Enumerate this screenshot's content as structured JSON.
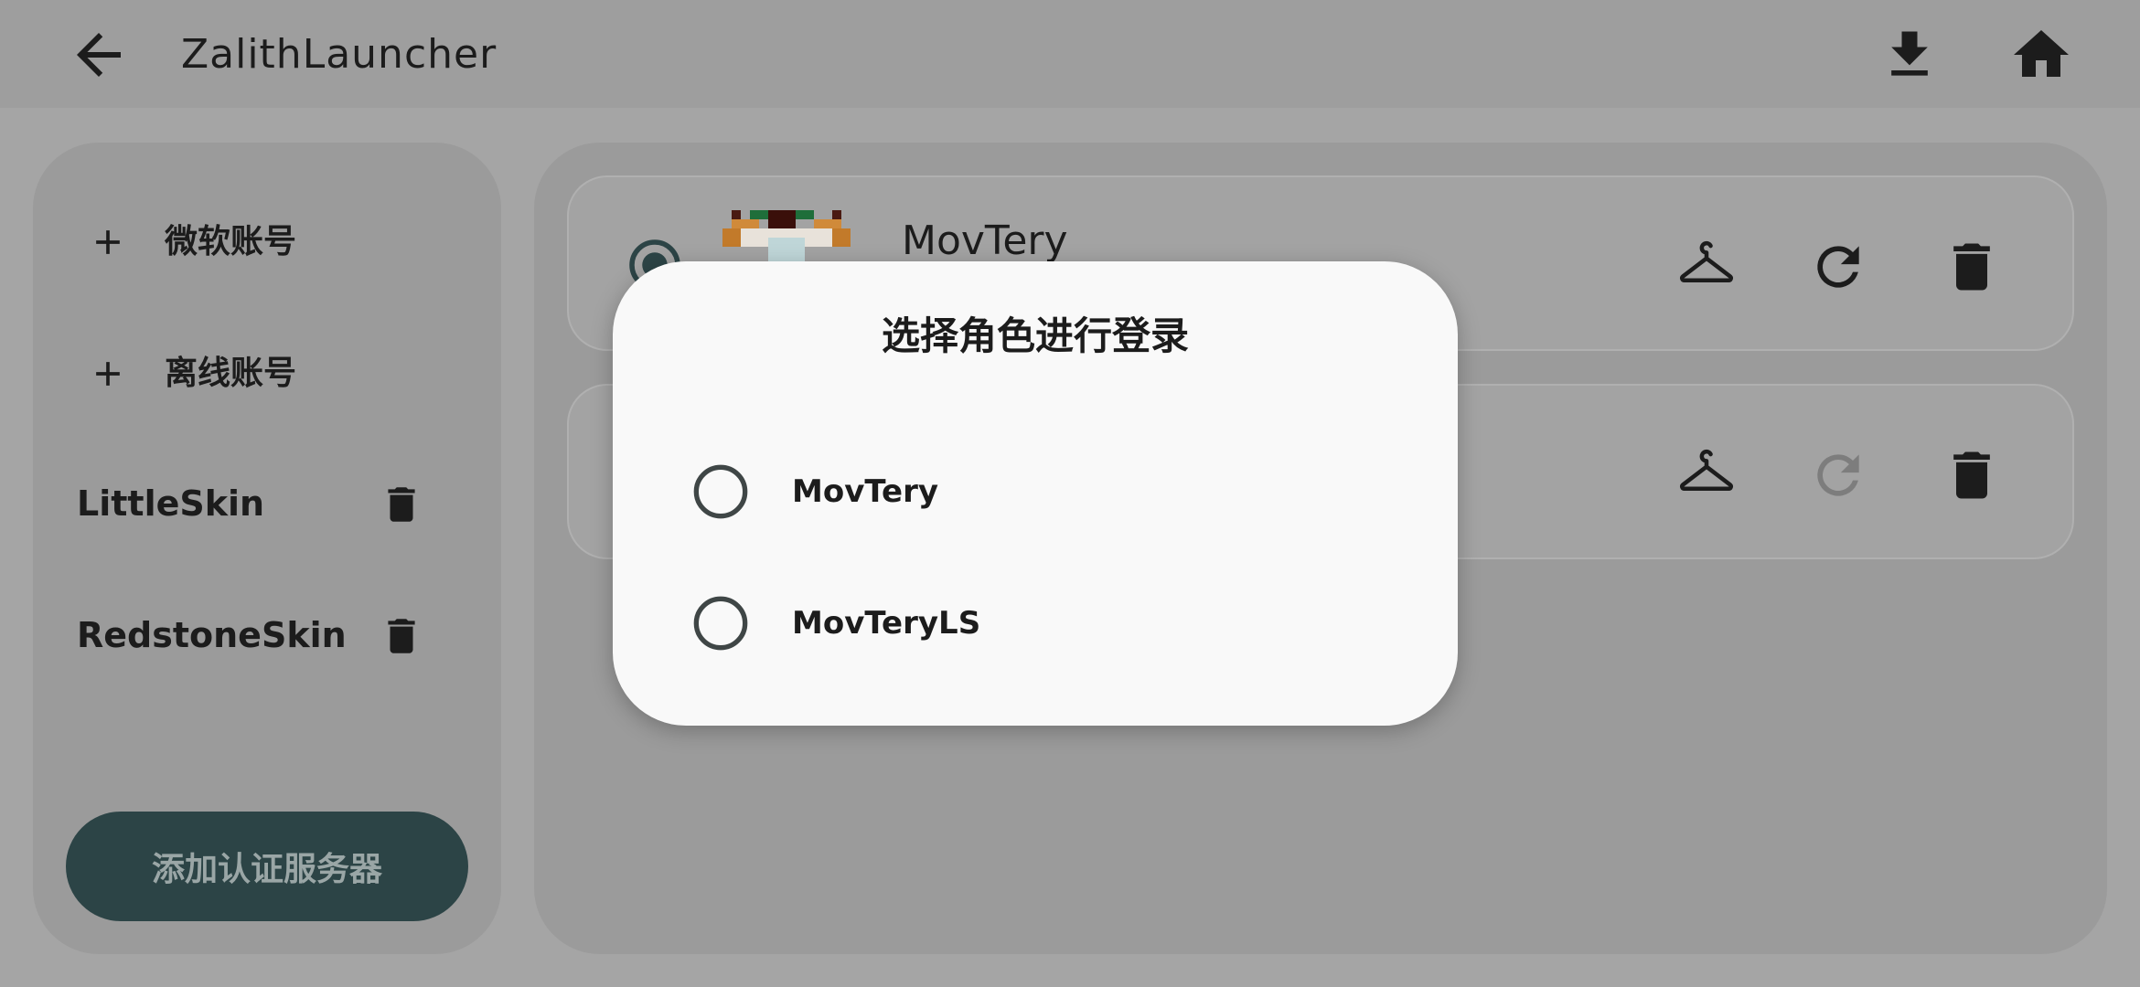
{
  "app": {
    "title": "ZalithLauncher"
  },
  "topbar": {
    "back_icon": "arrow-left-icon",
    "download_icon": "download-icon",
    "home_icon": "home-icon"
  },
  "sidebar": {
    "add_items": [
      {
        "label": "微软账号",
        "icon": "plus-icon"
      },
      {
        "label": "离线账号",
        "icon": "plus-icon"
      }
    ],
    "servers": [
      {
        "label": "LittleSkin",
        "icon": "trash-icon"
      },
      {
        "label": "RedstoneSkin",
        "icon": "trash-icon"
      }
    ],
    "add_server_label": "添加认证服务器"
  },
  "accounts": [
    {
      "name": "MovTery",
      "selected": true,
      "refresh_enabled": true
    },
    {
      "name": "",
      "selected": false,
      "refresh_enabled": false
    }
  ],
  "dialog": {
    "title": "选择角色进行登录",
    "options": [
      {
        "label": "MovTery",
        "selected": false
      },
      {
        "label": "MovTeryLS",
        "selected": false
      }
    ]
  },
  "colors": {
    "accent_dark": "#2c4446",
    "dialog_bg": "#f9f9f9",
    "scrim_bg": "#a5a5a5"
  }
}
